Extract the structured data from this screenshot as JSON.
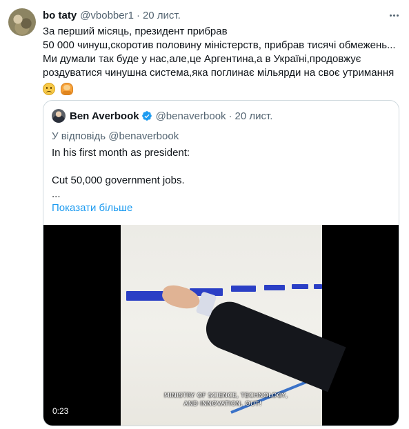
{
  "tweet": {
    "author_name": "bo taty",
    "author_handle": "@vbobber1",
    "separator": "·",
    "time": "20 лист.",
    "lines": [
      "За перший місяць, президент прибрав",
      "50 000 чинуш,скоротив половину міністерств, прибрав тисячі обмежень...",
      "Ми думали так буде у нас,але,це Аргентина,а в Україні,продовжує",
      "роздуватися чинушна система,яка поглинає мільярди на своє утримання"
    ],
    "emojis": [
      "sad-face-icon",
      "person-gesturing-icon"
    ]
  },
  "quote": {
    "author_name": "Ben Averbook",
    "author_handle": "@benaverbook",
    "separator": "·",
    "time": "20 лист.",
    "reply_to": "У відповідь @benaverbook",
    "lines": [
      "In his first month as president:",
      "",
      "Cut 50,000 government jobs.",
      "..."
    ],
    "show_more": "Показати більше",
    "video": {
      "caption_lines": [
        "MINISTRY OF SCIENCE, TECHNOLOGY,",
        "AND INNOVATION, OUT!"
      ],
      "duration": "0:23"
    }
  },
  "colors": {
    "text": "#0f1419",
    "secondary": "#536471",
    "link": "#1d9bf0",
    "border": "#cfd9de",
    "verified": "#1d9bf0"
  }
}
